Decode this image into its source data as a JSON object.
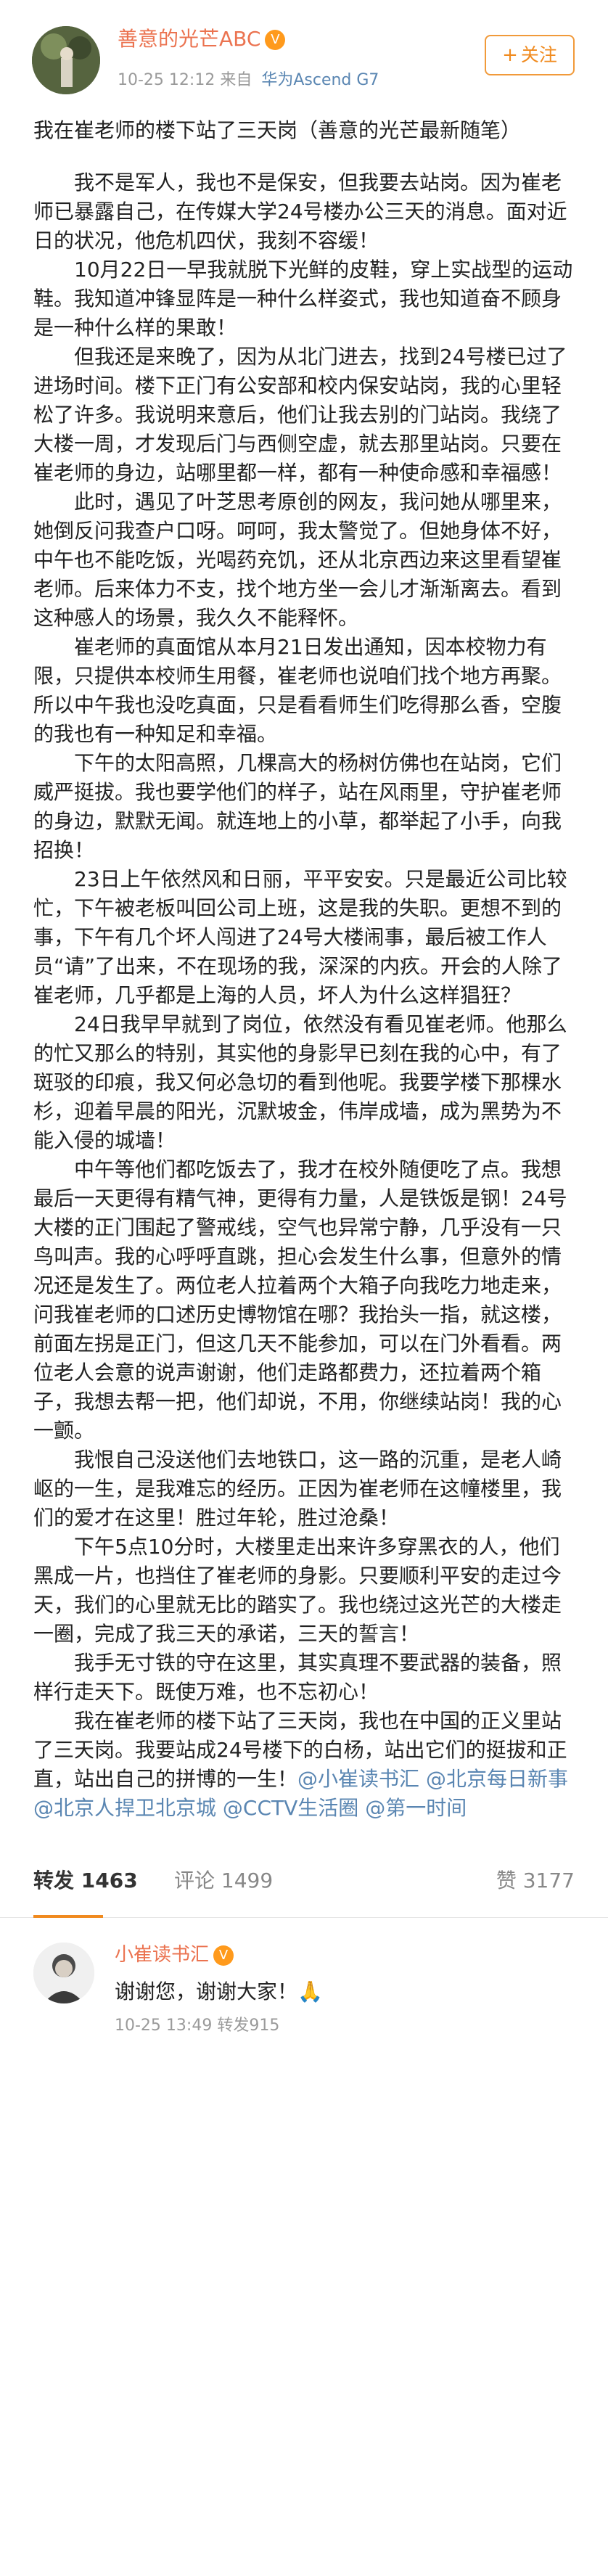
{
  "header": {
    "user_name": "善意的光芒ABC",
    "vip_badge": "V",
    "timestamp": "10-25 12:12",
    "source_prefix": "来自",
    "device": "华为Ascend G7",
    "follow_label": "关注",
    "follow_icon": "+"
  },
  "post": {
    "title": "我在崔老师的楼下站了三天岗（善意的光芒最新随笔）",
    "paragraphs": [
      "我不是军人，我也不是保安，但我要去站岗。因为崔老师已暴露自己，在传媒大学24号楼办公三天的消息。面对近日的状况，他危机四伏，我刻不容缓！",
      "10月22日一早我就脱下光鲜的皮鞋，穿上实战型的运动鞋。我知道冲锋显阵是一种什么样姿式，我也知道奋不顾身是一种什么样的果敢！",
      "但我还是来晚了，因为从北门进去，找到24号楼已过了进场时间。楼下正门有公安部和校内保安站岗，我的心里轻松了许多。我说明来意后，他们让我去别的门站岗。我绕了大楼一周，才发现后门与西侧空虚，就去那里站岗。只要在崔老师的身边，站哪里都一样，都有一种使命感和幸福感！",
      "此时，遇见了叶芝思考原创的网友，我问她从哪里来，她倒反问我查户口呀。呵呵，我太警觉了。但她身体不好，中午也不能吃饭，光喝药充饥，还从北京西边来这里看望崔老师。后来体力不支，找个地方坐一会儿才渐渐离去。看到这种感人的场景，我久久不能释怀。",
      "崔老师的真面馆从本月21日发出通知，因本校物力有限，只提供本校师生用餐，崔老师也说咱们找个地方再聚。所以中午我也没吃真面，只是看看师生们吃得那么香，空腹的我也有一种知足和幸福。",
      "下午的太阳高照，几棵高大的杨树仿佛也在站岗，它们威严挺拔。我也要学他们的样子，站在风雨里，守护崔老师的身边，默默无闻。就连地上的小草，都举起了小手，向我招换！",
      "23日上午依然风和日丽，平平安安。只是最近公司比较忙，下午被老板叫回公司上班，这是我的失职。更想不到的事，下午有几个坏人闯进了24号大楼闹事，最后被工作人员“请”了出来，不在现场的我，深深的内疚。开会的人除了崔老师，几乎都是上海的人员，坏人为什么这样猖狂？",
      "24日我早早就到了岗位，依然没有看见崔老师。他那么的忙又那么的特别，其实他的身影早已刻在我的心中，有了斑驳的印痕，我又何必急切的看到他呢。我要学楼下那棵水杉，迎着早晨的阳光，沉默坡金，伟岸成墙，成为黑势为不能入侵的城墙！",
      "中午等他们都吃饭去了，我才在校外随便吃了点。我想最后一天更得有精气神，更得有力量，人是铁饭是钢！24号大楼的正门围起了警戒线，空气也异常宁静，几乎没有一只鸟叫声。我的心呼呼直跳，担心会发生什么事，但意外的情况还是发生了。两位老人拉着两个大箱子向我吃力地走来，问我崔老师的口述历史博物馆在哪？我抬头一指，就这楼，前面左拐是正门，但这几天不能参加，可以在门外看看。两位老人会意的说声谢谢，他们走路都费力，还拉着两个箱子，我想去帮一把，他们却说，不用，你继续站岗！我的心一颤。",
      "我恨自己没送他们去地铁口，这一路的沉重，是老人崎岖的一生，是我难忘的经历。正因为崔老师在这幢楼里，我们的爱才在这里！胜过年轮，胜过沧桑！",
      "下午5点10分时，大楼里走出来许多穿黑衣的人，他们黑成一片，也挡住了崔老师的身影。只要顺利平安的走过今天，我们的心里就无比的踏实了。我也绕过这光芒的大楼走一圈，完成了我三天的承诺，三天的誓言！",
      "我手无寸铁的守在这里，其实真理不要武器的装备，照样行走天下。既使万难，也不忘初心！"
    ],
    "final_paragraph": "我在崔老师的楼下站了三天岗，我也在中国的正义里站了三天岗。我要站成24号楼下的白杨，站出它们的挺拔和正直，站出自己的拼博的一生！",
    "mentions": [
      "@小崔读书汇",
      "@北京每日新事",
      "@北京人捍卫北京城",
      "@CCTV生活圈",
      "@第一时间"
    ]
  },
  "actions": {
    "repost_label": "转发",
    "repost_count": "1463",
    "comment_label": "评论",
    "comment_count": "1499",
    "like_label": "赞",
    "like_count": "3177"
  },
  "repost": {
    "user_name": "小崔读书汇",
    "vip_badge": "V",
    "text": "谢谢您，谢谢大家！🙏",
    "timestamp": "10-25 13:49",
    "repost_label": "转发915"
  },
  "colors": {
    "username": "#eb7350",
    "link": "#5a86b2",
    "follow": "#f08a1e"
  }
}
